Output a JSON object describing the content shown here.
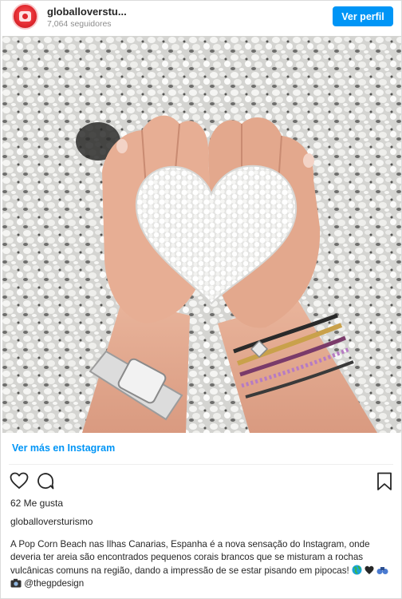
{
  "header": {
    "username": "globalloverstu...",
    "followers": "7,064 seguidores",
    "follow_label": "Ver perfil"
  },
  "post": {
    "image_alt": "Hands holding white popcorn-like coral in a heart shape",
    "view_more_label": "Ver más en Instagram",
    "likes": "62 Me gusta",
    "caption_user": "globalloversturismo",
    "caption_text": "A Pop Corn Beach nas Ilhas Canarias, Espanha é a nova sensação do Instagram, onde deveria ter areia são encontrados pequenos corais brancos que se misturam a rochas vulcânicas comuns na região, dando a impressão de se estar pisando em pipocas!",
    "caption_credit": "@thegpdesign"
  },
  "icons": [
    "heart-icon",
    "comment-icon",
    "bookmark-icon",
    "globe-emoji-icon",
    "heart-emoji-icon",
    "binoculars-emoji-icon",
    "camera-emoji-icon"
  ],
  "colors": {
    "accent": "#0095f6",
    "text": "#262626",
    "muted": "#8e8e8e",
    "avatar": "#e0282e"
  }
}
